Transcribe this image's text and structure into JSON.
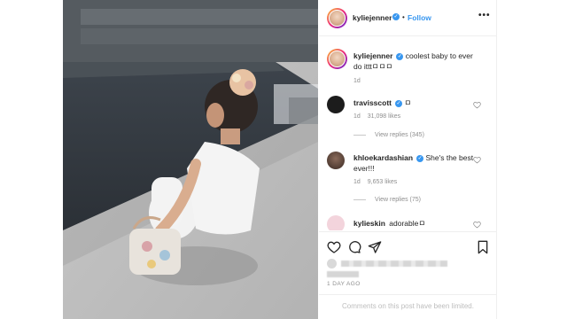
{
  "post": {
    "image_alt": "child in white top sitting on pool deck holding small bag",
    "author": "kyliejenner",
    "follow_separator": "•",
    "follow_label": "Follow",
    "more_label": "•••",
    "verified_mark": "✓"
  },
  "caption": {
    "username": "kyliejenner",
    "text": "coolest baby to ever do itttㅁㅁㅁ",
    "time": "1d"
  },
  "comments": [
    {
      "username": "travisscott",
      "text": "ㅁ",
      "time": "1d",
      "likes": "31,098 likes",
      "view_replies": "View replies (345)"
    },
    {
      "username": "khloekardashian",
      "text": "She's the best ever!!!",
      "time": "1d",
      "likes": "9,653 likes",
      "view_replies": "View replies (75)"
    },
    {
      "username": "kylieskin",
      "text": "adorableㅁ"
    }
  ],
  "actions": {
    "like_icon": "heart-icon",
    "comment_icon": "comment-icon",
    "share_icon": "share-icon",
    "save_icon": "bookmark-icon"
  },
  "footer": {
    "timestamp": "1 DAY AGO",
    "comments_limited": "Comments on this post have been limited."
  },
  "colors": {
    "accent_blue": "#3897f0",
    "text": "#262626",
    "muted": "#8e8e8e",
    "border": "#efefef"
  }
}
